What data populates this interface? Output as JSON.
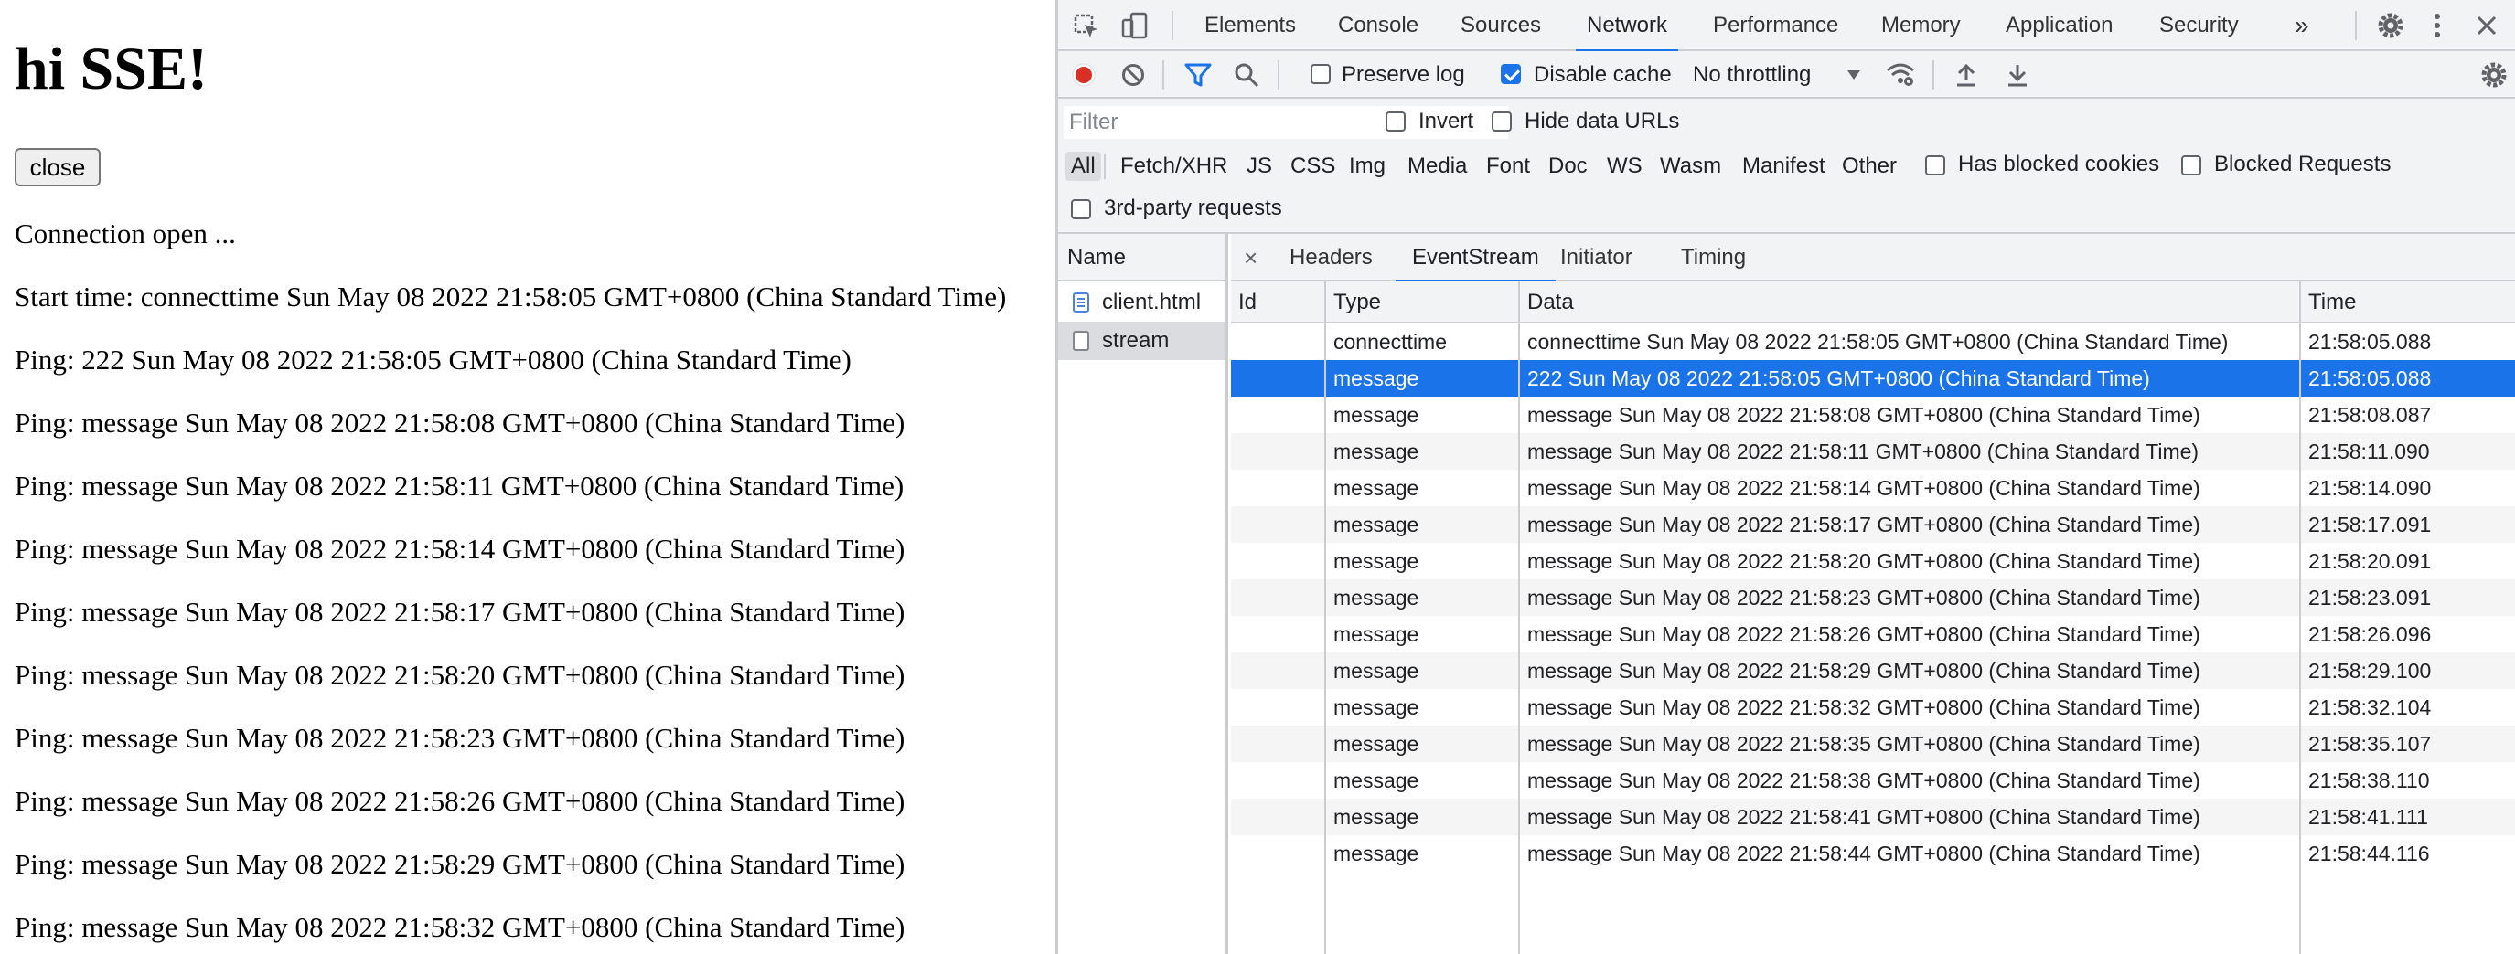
{
  "page": {
    "heading": "hi SSE!",
    "close_label": "close",
    "lines": [
      "Connection open ...",
      "Start time: connecttime Sun May 08 2022 21:58:05 GMT+0800 (China Standard Time)",
      "Ping: 222 Sun May 08 2022 21:58:05 GMT+0800 (China Standard Time)",
      "Ping: message Sun May 08 2022 21:58:08 GMT+0800 (China Standard Time)",
      "Ping: message Sun May 08 2022 21:58:11 GMT+0800 (China Standard Time)",
      "Ping: message Sun May 08 2022 21:58:14 GMT+0800 (China Standard Time)",
      "Ping: message Sun May 08 2022 21:58:17 GMT+0800 (China Standard Time)",
      "Ping: message Sun May 08 2022 21:58:20 GMT+0800 (China Standard Time)",
      "Ping: message Sun May 08 2022 21:58:23 GMT+0800 (China Standard Time)",
      "Ping: message Sun May 08 2022 21:58:26 GMT+0800 (China Standard Time)",
      "Ping: message Sun May 08 2022 21:58:29 GMT+0800 (China Standard Time)",
      "Ping: message Sun May 08 2022 21:58:32 GMT+0800 (China Standard Time)"
    ]
  },
  "devtools": {
    "tabs": [
      "Elements",
      "Console",
      "Sources",
      "Network",
      "Performance",
      "Memory",
      "Application",
      "Security"
    ],
    "active_tab": "Network",
    "more_tabs": "»",
    "toolbar": {
      "preserve_log": "Preserve log",
      "disable_cache": "Disable cache",
      "throttling": "No throttling"
    },
    "filter": {
      "placeholder": "Filter",
      "invert": "Invert",
      "hide_data_urls": "Hide data URLs",
      "types": [
        "All",
        "Fetch/XHR",
        "JS",
        "CSS",
        "Img",
        "Media",
        "Font",
        "Doc",
        "WS",
        "Wasm",
        "Manifest",
        "Other"
      ],
      "has_blocked_cookies": "Has blocked cookies",
      "blocked_requests": "Blocked Requests",
      "third_party": "3rd-party requests"
    },
    "name_column": {
      "header": "Name",
      "items": [
        "client.html",
        "stream"
      ]
    },
    "detail": {
      "close": "×",
      "tabs": [
        "Headers",
        "EventStream",
        "Initiator",
        "Timing"
      ],
      "active_tab": "EventStream"
    },
    "events": {
      "columns": [
        "Id",
        "Type",
        "Data",
        "Time"
      ],
      "rows": [
        {
          "id": "",
          "type": "connecttime",
          "data": "connecttime Sun May 08 2022 21:58:05 GMT+0800 (China Standard Time)",
          "time": "21:58:05.088"
        },
        {
          "id": "",
          "type": "message",
          "data": "222 Sun May 08 2022 21:58:05 GMT+0800 (China Standard Time)",
          "time": "21:58:05.088"
        },
        {
          "id": "",
          "type": "message",
          "data": "message Sun May 08 2022 21:58:08 GMT+0800 (China Standard Time)",
          "time": "21:58:08.087"
        },
        {
          "id": "",
          "type": "message",
          "data": "message Sun May 08 2022 21:58:11 GMT+0800 (China Standard Time)",
          "time": "21:58:11.090"
        },
        {
          "id": "",
          "type": "message",
          "data": "message Sun May 08 2022 21:58:14 GMT+0800 (China Standard Time)",
          "time": "21:58:14.090"
        },
        {
          "id": "",
          "type": "message",
          "data": "message Sun May 08 2022 21:58:17 GMT+0800 (China Standard Time)",
          "time": "21:58:17.091"
        },
        {
          "id": "",
          "type": "message",
          "data": "message Sun May 08 2022 21:58:20 GMT+0800 (China Standard Time)",
          "time": "21:58:20.091"
        },
        {
          "id": "",
          "type": "message",
          "data": "message Sun May 08 2022 21:58:23 GMT+0800 (China Standard Time)",
          "time": "21:58:23.091"
        },
        {
          "id": "",
          "type": "message",
          "data": "message Sun May 08 2022 21:58:26 GMT+0800 (China Standard Time)",
          "time": "21:58:26.096"
        },
        {
          "id": "",
          "type": "message",
          "data": "message Sun May 08 2022 21:58:29 GMT+0800 (China Standard Time)",
          "time": "21:58:29.100"
        },
        {
          "id": "",
          "type": "message",
          "data": "message Sun May 08 2022 21:58:32 GMT+0800 (China Standard Time)",
          "time": "21:58:32.104"
        },
        {
          "id": "",
          "type": "message",
          "data": "message Sun May 08 2022 21:58:35 GMT+0800 (China Standard Time)",
          "time": "21:58:35.107"
        },
        {
          "id": "",
          "type": "message",
          "data": "message Sun May 08 2022 21:58:38 GMT+0800 (China Standard Time)",
          "time": "21:58:38.110"
        },
        {
          "id": "",
          "type": "message",
          "data": "message Sun May 08 2022 21:58:41 GMT+0800 (China Standard Time)",
          "time": "21:58:41.111"
        },
        {
          "id": "",
          "type": "message",
          "data": "message Sun May 08 2022 21:58:44 GMT+0800 (China Standard Time)",
          "time": "21:58:44.116"
        }
      ]
    }
  },
  "colors": {
    "accent": "#1a73e8",
    "record": "#d93025",
    "toolbar_bg": "#f1f3f4"
  }
}
